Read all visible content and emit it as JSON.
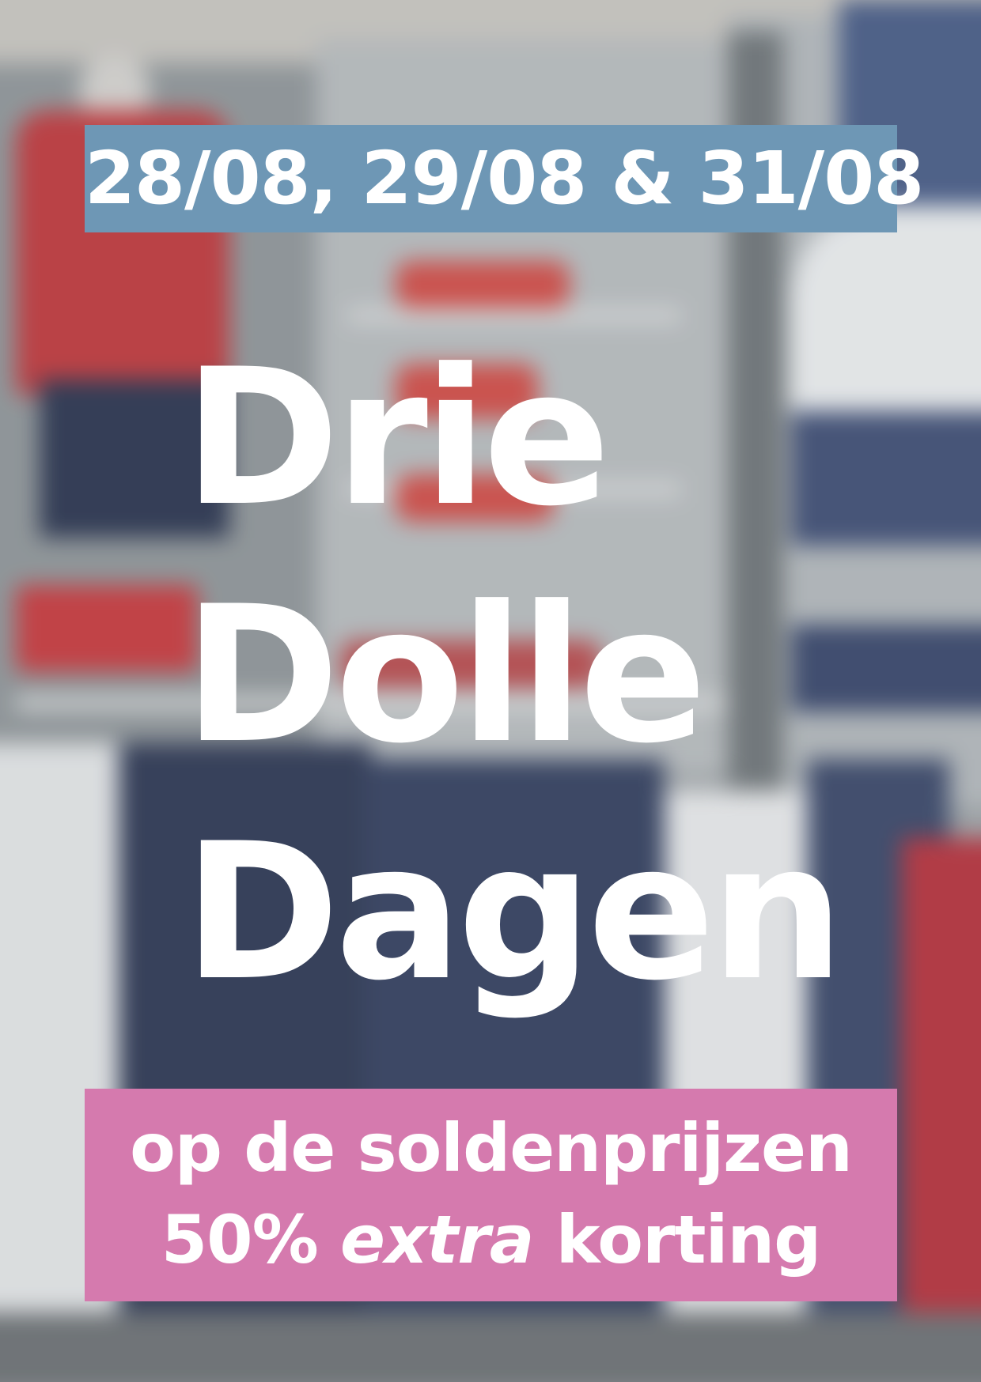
{
  "dates_banner": {
    "text": "28/08, 29/08 & 31/08",
    "color": "#6e97b5"
  },
  "headline": {
    "line1": "Drie",
    "line2": "Dolle",
    "line3": "Dagen",
    "color": "#ffffff"
  },
  "promo_banner": {
    "line1": "op de soldenprijzen",
    "line2_prefix": "50%",
    "line2_emphasis": "extra",
    "line2_suffix": "korting",
    "color": "#d57aae"
  }
}
